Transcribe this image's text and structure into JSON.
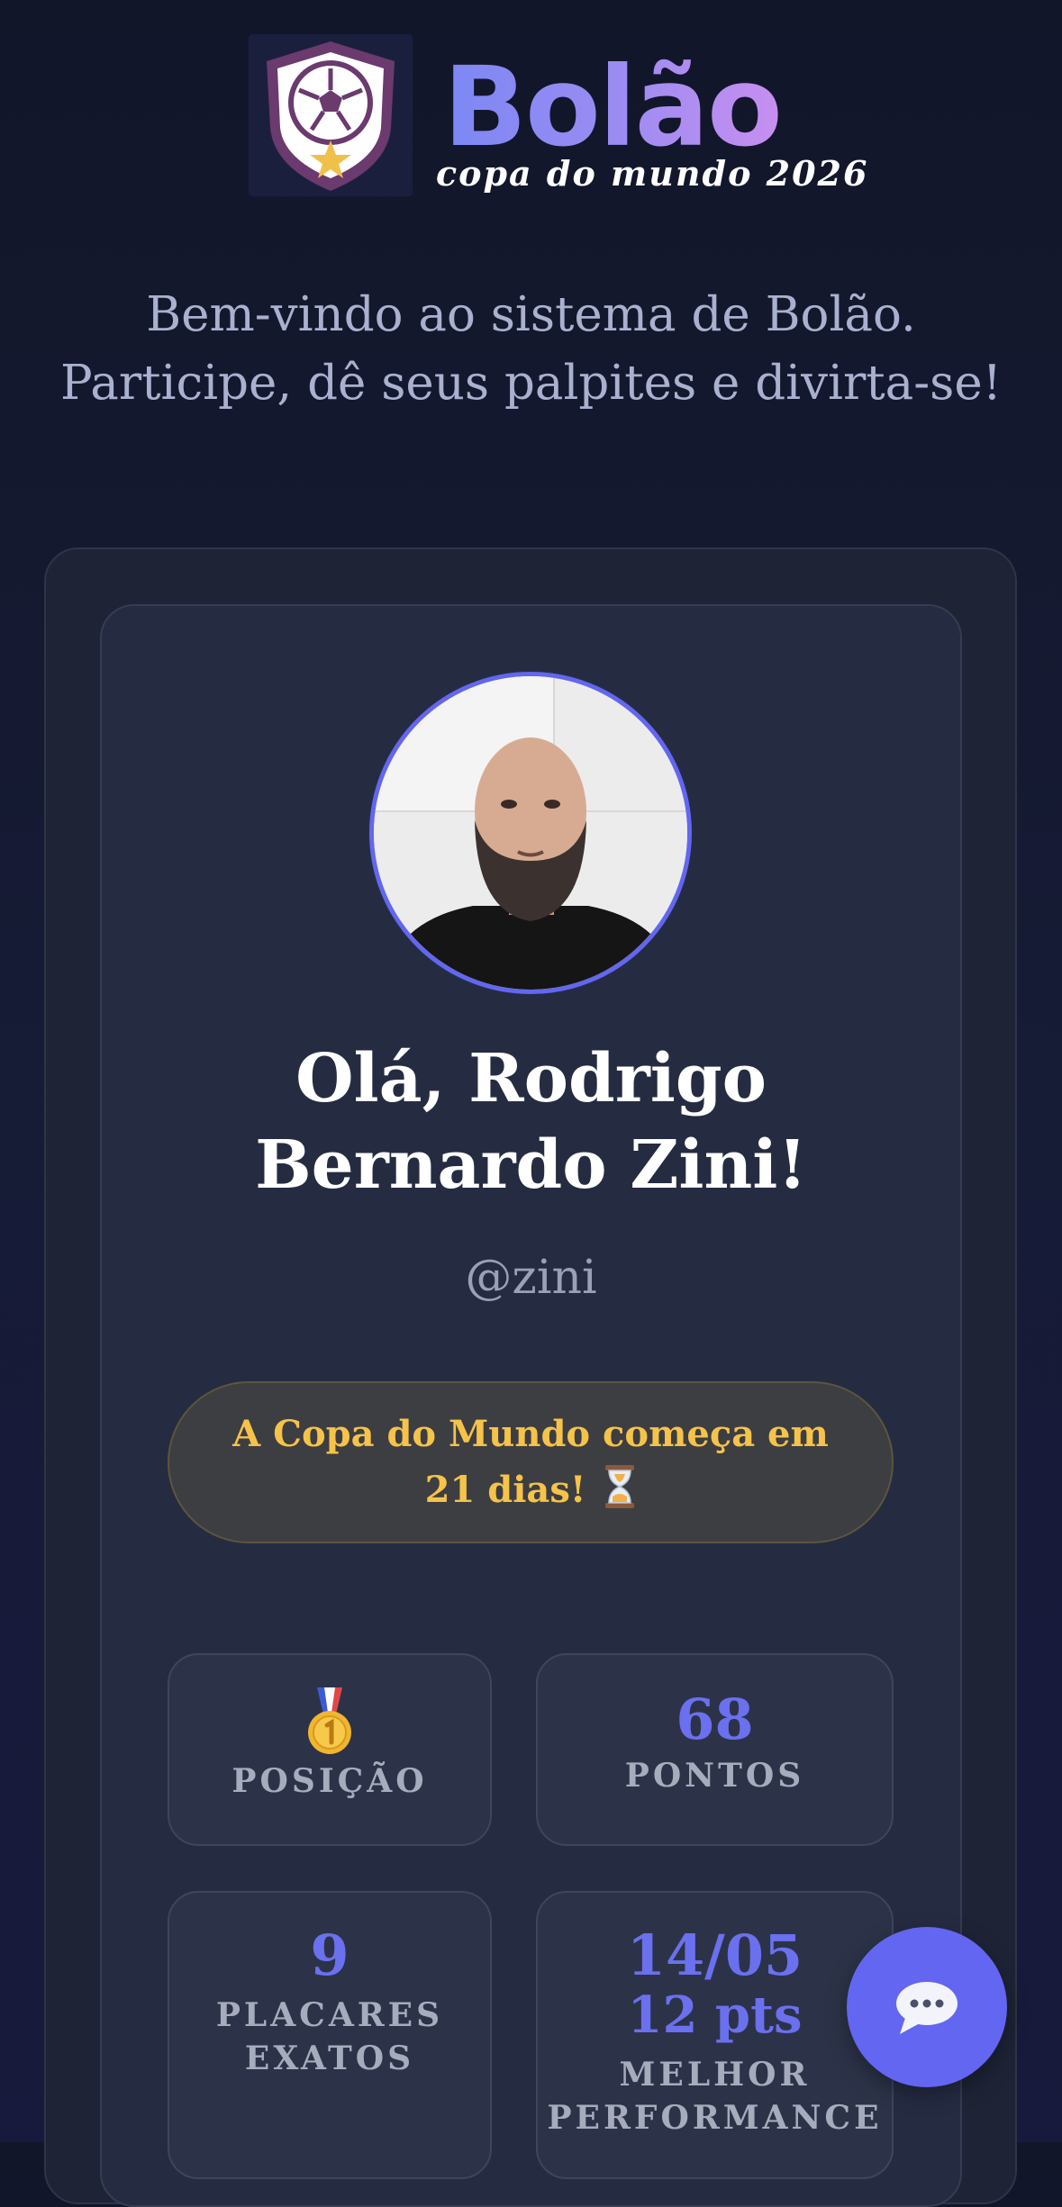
{
  "header": {
    "brand_title": "Bolão",
    "brand_subtitle": "copa do mundo 2026",
    "logo_icon": "soccer-shield-logo"
  },
  "intro": {
    "text": "Bem-vindo ao sistema de Bolão. Participe, dê seus palpites e divirta-se!"
  },
  "profile": {
    "avatar_icon": "user-avatar-photo",
    "greeting": "Olá, Rodrigo Bernardo Zini!",
    "username": "@zini"
  },
  "countdown": {
    "text": "A Copa do Mundo começa em 21 dias!",
    "icon": "hourglass-icon"
  },
  "stats": {
    "position": {
      "icon": "first-place-medal-icon",
      "label": "POSIÇÃO"
    },
    "points": {
      "value": "68",
      "label": "PONTOS"
    },
    "exact_scores": {
      "value": "9",
      "label": "PLACARES EXATOS"
    },
    "best_performance": {
      "date": "14/05",
      "points": "12 pts",
      "label": "MELHOR PERFORMANCE"
    }
  },
  "chat": {
    "icon": "chat-bubble-icon"
  },
  "colors": {
    "accent": "#6366f1",
    "countdown_text": "#f6c34a",
    "brand_gradient_start": "#7c87f4",
    "brand_gradient_end": "#c78ff0"
  }
}
